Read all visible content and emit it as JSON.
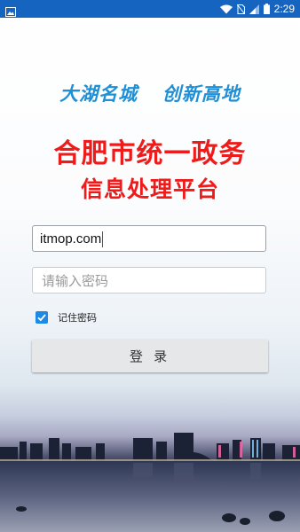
{
  "status_bar": {
    "time": "2:29",
    "icons": [
      "image-icon",
      "wifi-icon",
      "sim-off-icon",
      "signal-icon",
      "battery-icon"
    ]
  },
  "slogan": {
    "part1": "大湖名城",
    "part2": "创新高地"
  },
  "title": {
    "line1": "合肥市统一政务",
    "line2": "信息处理平台"
  },
  "login_form": {
    "username_value": "itmop.com",
    "password_placeholder": "请输入密码",
    "remember_label": "记住密码",
    "remember_checked": true,
    "login_button_label": "登 录"
  },
  "colors": {
    "status_bar": "#1565c0",
    "slogan": "#1f8fd6",
    "title": "#ef1b1b",
    "checkbox": "#1e88e5"
  }
}
